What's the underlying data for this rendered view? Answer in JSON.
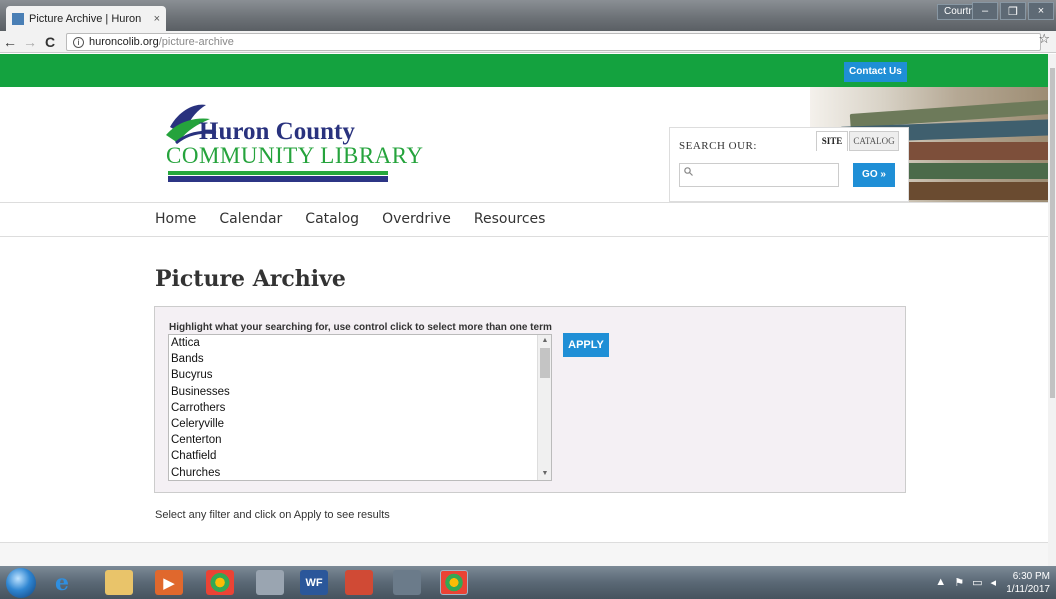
{
  "browser": {
    "tab_title": "Picture Archive | Huron",
    "tab_close": "×",
    "user_name": "Courtney",
    "window_controls": [
      "–",
      "❐",
      "×"
    ],
    "url_host": "huroncolib.org",
    "url_path": "/picture-archive",
    "info_glyph": "i",
    "nav_back": "←",
    "nav_forward": "→",
    "nav_reload": "C",
    "star": "☆"
  },
  "header": {
    "contact_label": "Contact Us",
    "logo_line1": "Huron County",
    "logo_line2": "COMMUNITY LIBRARY",
    "search_label": "SEARCH OUR:",
    "tab_site": "SITE",
    "tab_catalog": "CATALOG",
    "search_placeholder": "",
    "go_label": "GO »"
  },
  "nav": {
    "items": [
      "Home",
      "Calendar",
      "Catalog",
      "Overdrive",
      "Resources"
    ]
  },
  "main": {
    "title": "Picture Archive",
    "filter_hint": "Highlight what your searching for, use control click to select more than one term",
    "terms": [
      "Attica",
      "Bands",
      "Bucyrus",
      "Businesses",
      "Carrothers",
      "Celeryville",
      "Centerton",
      "Chatfield",
      "Churches"
    ],
    "apply_label": "APPLY",
    "result_hint": "Select any filter and click on Apply to see results"
  },
  "taskbar": {
    "clock_time": "6:30 PM",
    "clock_date": "1/11/2017"
  },
  "colors": {
    "green": "#14a23f",
    "blue": "#1f8fd6",
    "navy": "#29327e"
  }
}
